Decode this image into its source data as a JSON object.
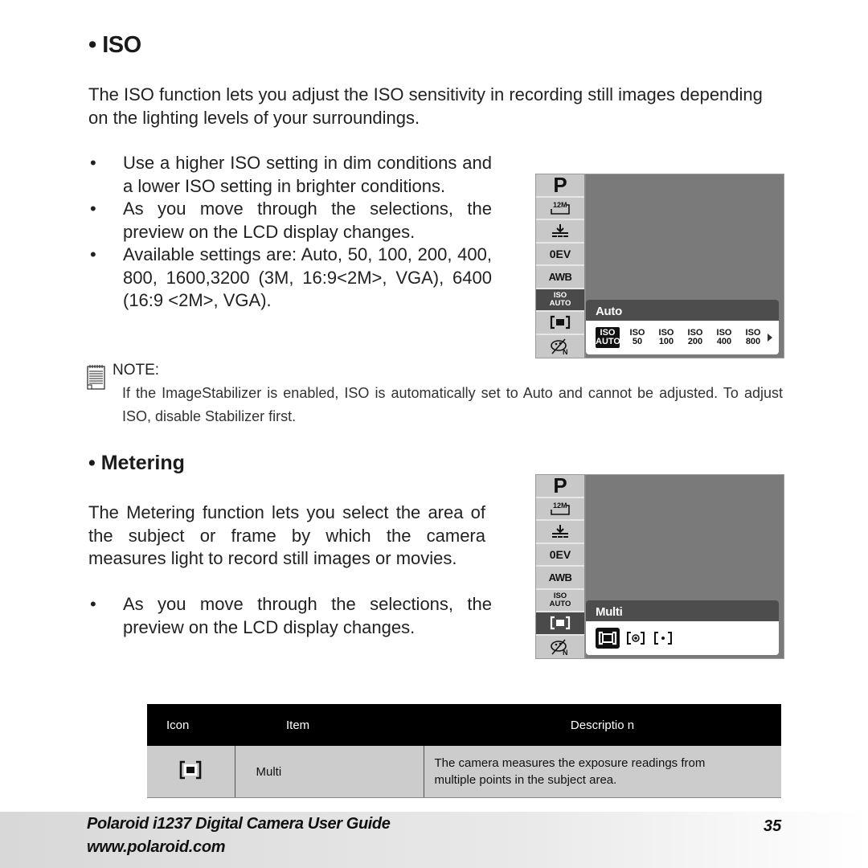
{
  "iso_section": {
    "heading": "• ISO",
    "intro": "The ISO function lets you adjust the ISO sensitivity in recording still images depending on the lighting levels of your surroundings.",
    "bullets": [
      "Use a higher ISO setting in dim conditions and a lower ISO setting in brighter conditions.",
      "As you move through the selections, the preview on the LCD display changes.",
      "Available settings are: Auto, 50, 100, 200, 400, 800, 1600,3200 (3M, 16:9<2M>, VGA), 6400 (16:9 <2M>, VGA)."
    ],
    "note_title": "NOTE:",
    "note_text": "If the ImageStabilizer is enabled, ISO is automatically set to Auto and cannot be adjusted. To adjust ISO, disable Stabilizer first.",
    "lcd": {
      "sidebar": [
        "P",
        "12M",
        "quality",
        "0EV",
        "AWB",
        "ISO AUTO",
        "metering",
        "face"
      ],
      "active_index": 5,
      "popup_title": "Auto",
      "options": [
        {
          "top": "ISO",
          "bottom": "AUTO",
          "selected": true
        },
        {
          "top": "ISO",
          "bottom": "50"
        },
        {
          "top": "ISO",
          "bottom": "100"
        },
        {
          "top": "ISO",
          "bottom": "200"
        },
        {
          "top": "ISO",
          "bottom": "400"
        },
        {
          "top": "ISO",
          "bottom": "800"
        }
      ],
      "more_icon": "arrow-right-icon"
    }
  },
  "metering_section": {
    "heading": "• Metering",
    "intro": "The Metering function lets you select the area of the subject or frame by which the camera measures light to record still images or movies.",
    "bullets": [
      "As you move through the selections, the preview on the LCD display changes."
    ],
    "lcd": {
      "sidebar": [
        "P",
        "12M",
        "quality",
        "0EV",
        "AWB",
        "ISO AUTO",
        "metering",
        "face"
      ],
      "active_index": 6,
      "popup_title": "Multi",
      "options": [
        "multi-metering-icon",
        "center-metering-icon",
        "spot-metering-icon"
      ],
      "selected_index": 0
    }
  },
  "table": {
    "headers": [
      "Icon",
      "Item",
      "Descriptio n"
    ],
    "rows": [
      {
        "icon": "multi-metering-icon",
        "item": "Multi",
        "description": "The camera measures the exposure readings from multiple points in the subject area."
      }
    ]
  },
  "footer": {
    "title": "Polaroid i1237 Digital Camera User Guide",
    "url": "www.polaroid.com",
    "page": "35"
  }
}
